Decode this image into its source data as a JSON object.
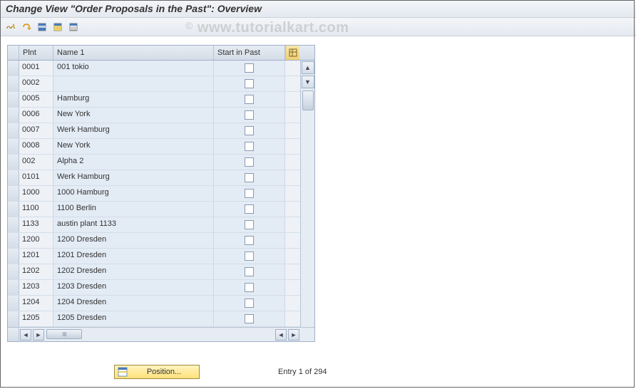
{
  "title": "Change View \"Order Proposals in the Past\": Overview",
  "watermark": "www.tutorialkart.com",
  "toolbar": {
    "icons": [
      "undo-icon",
      "glasses-icon",
      "select-all-icon",
      "select-block-icon",
      "deselect-all-icon"
    ]
  },
  "columns": {
    "plnt": "Plnt",
    "name": "Name 1",
    "start": "Start in Past"
  },
  "rows": [
    {
      "plnt": "0001",
      "name": "001 tokio",
      "start": false
    },
    {
      "plnt": "0002",
      "name": "",
      "start": false
    },
    {
      "plnt": "0005",
      "name": "Hamburg",
      "start": false
    },
    {
      "plnt": "0006",
      "name": "New York",
      "start": false
    },
    {
      "plnt": "0007",
      "name": "Werk Hamburg",
      "start": false
    },
    {
      "plnt": "0008",
      "name": "New York",
      "start": false
    },
    {
      "plnt": "002",
      "name": "Alpha 2",
      "start": false
    },
    {
      "plnt": "0101",
      "name": "Werk Hamburg",
      "start": false
    },
    {
      "plnt": "1000",
      "name": "1000 Hamburg",
      "start": false
    },
    {
      "plnt": "1100",
      "name": "1100 Berlin",
      "start": false
    },
    {
      "plnt": "1133",
      "name": "austin plant 1133",
      "start": false
    },
    {
      "plnt": "1200",
      "name": "1200 Dresden",
      "start": false
    },
    {
      "plnt": "1201",
      "name": "1201 Dresden",
      "start": false
    },
    {
      "plnt": "1202",
      "name": "1202 Dresden",
      "start": false
    },
    {
      "plnt": "1203",
      "name": "1203 Dresden",
      "start": false
    },
    {
      "plnt": "1204",
      "name": "1204 Dresden",
      "start": false
    },
    {
      "plnt": "1205",
      "name": "1205 Dresden",
      "start": false
    }
  ],
  "footer": {
    "position_label": "Position...",
    "entry_label": "Entry 1 of 294"
  }
}
